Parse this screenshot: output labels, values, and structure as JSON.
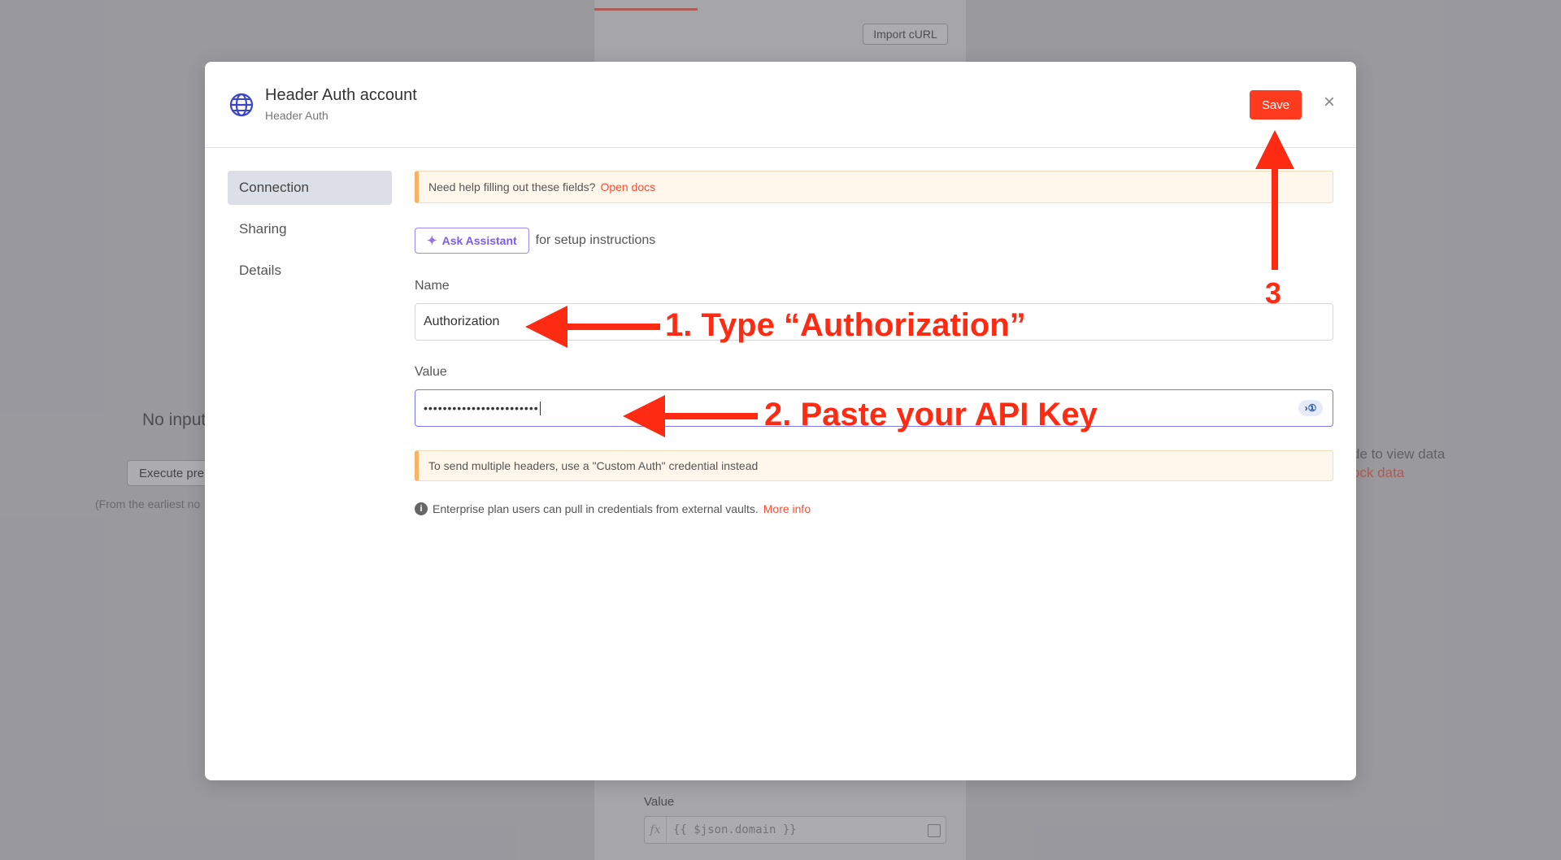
{
  "background": {
    "import_curl": "Import cURL",
    "no_input": "No input",
    "execute_btn": "Execute pre",
    "earliest_note": "(From the earliest no",
    "right_text_1": "de to view data",
    "right_text_2": "ock data",
    "value_label": "Value",
    "value_expr": "{{ $json.domain }}",
    "fx_label": "fx"
  },
  "modal": {
    "title": "Header Auth account",
    "subtitle": "Header Auth",
    "save_label": "Save",
    "close_glyph": "×"
  },
  "nav": {
    "items": [
      {
        "label": "Connection",
        "active": true
      },
      {
        "label": "Sharing",
        "active": false
      },
      {
        "label": "Details",
        "active": false
      }
    ]
  },
  "content": {
    "help_text": "Need help filling out these fields?",
    "help_link": "Open docs",
    "ask_assistant": "Ask Assistant",
    "assistant_suffix": "for setup instructions",
    "name_label": "Name",
    "name_value": "Authorization",
    "value_label": "Value",
    "value_masked": "••••••••••••••••••••••••",
    "multi_header_note": "To send multiple headers, use a \"Custom Auth\" credential instead",
    "enterprise_text": "Enterprise plan users can pull in credentials from external vaults.",
    "more_info": "More info"
  },
  "annotations": {
    "step1": "1. Type “Authorization”",
    "step2": "2. Paste your API Key",
    "step3": "3",
    "color": "#ff2a12"
  }
}
